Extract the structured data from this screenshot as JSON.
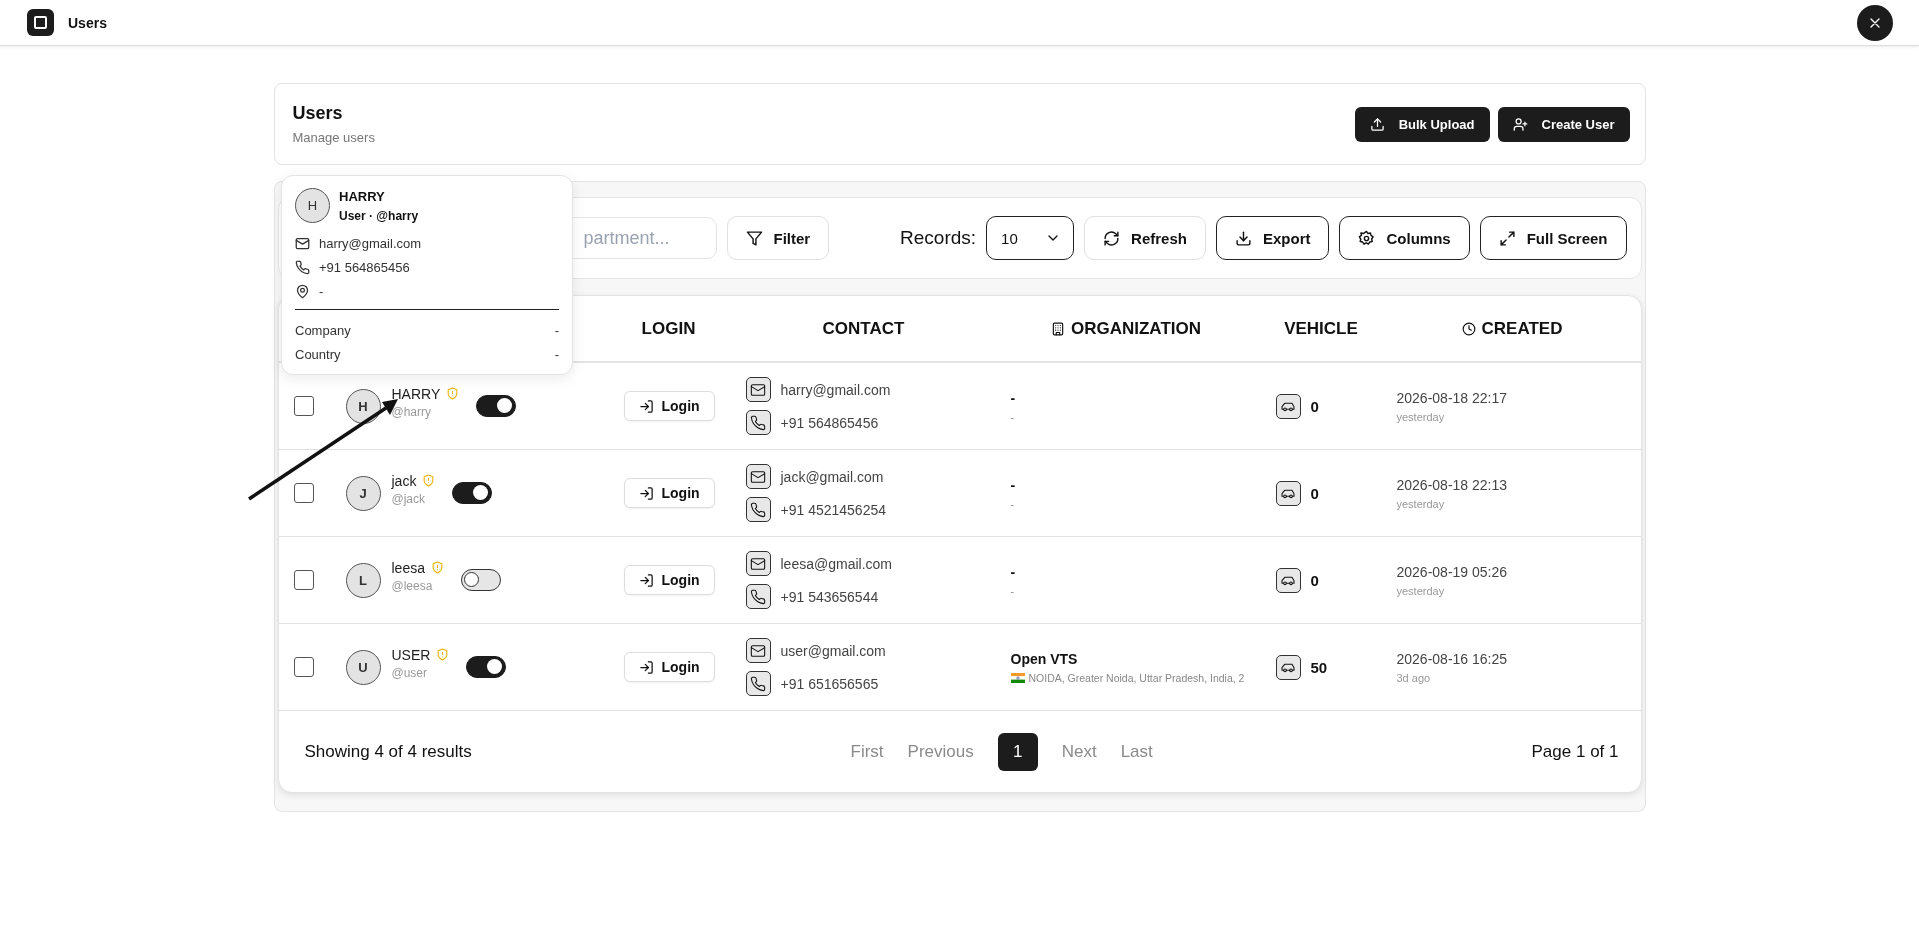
{
  "app_bar": {
    "title": "Users"
  },
  "page_header": {
    "title": "Users",
    "subtitle": "Manage users",
    "actions": [
      "Bulk Upload",
      "Create User"
    ]
  },
  "toolbar": {
    "search": {
      "placeholder": "partment..."
    },
    "filter": {
      "label": "Filter",
      "kind": "plain"
    },
    "records_label": "Records:",
    "records_value": "10",
    "buttons": [
      {
        "label": "Refresh",
        "kind": "plain"
      },
      {
        "label": "Export",
        "kind": "outline"
      },
      {
        "label": "Columns",
        "kind": "outline"
      },
      {
        "label": "Full Screen",
        "kind": "outline"
      }
    ]
  },
  "table": {
    "columns": [
      "LOGIN",
      "CONTACT",
      "ORGANIZATION",
      "VEHICLE",
      "CREATED"
    ],
    "rows": [
      {
        "initial": "H",
        "name": "HARRY",
        "handle": "@harry",
        "checked": false,
        "active": true,
        "login_label": "Login",
        "email": "harry@gmail.com",
        "phone": "+91 564865456",
        "organization": "-",
        "location": "-",
        "flag": false,
        "vehicles": "0",
        "created": "2026-08-18 22:17",
        "created_relative": "yesterday"
      },
      {
        "initial": "J",
        "name": "jack",
        "handle": "@jack",
        "checked": false,
        "active": true,
        "login_label": "Login",
        "email": "jack@gmail.com",
        "phone": "+91 4521456254",
        "organization": "-",
        "location": "-",
        "flag": false,
        "vehicles": "0",
        "created": "2026-08-18 22:13",
        "created_relative": "yesterday"
      },
      {
        "initial": "L",
        "name": "leesa",
        "handle": "@leesa",
        "checked": false,
        "active": false,
        "login_label": "Login",
        "email": "leesa@gmail.com",
        "phone": "+91 543656544",
        "organization": "-",
        "location": "-",
        "flag": false,
        "vehicles": "0",
        "created": "2026-08-19 05:26",
        "created_relative": "yesterday"
      },
      {
        "initial": "U",
        "name": "USER",
        "handle": "@user",
        "checked": false,
        "active": true,
        "login_label": "Login",
        "email": "user@gmail.com",
        "phone": "+91 651656565",
        "organization": "Open VTS",
        "location": "NOIDA, Greater Noida, Uttar Pradesh, India, 2",
        "flag": true,
        "vehicles": "50",
        "created": "2026-08-16 16:25",
        "created_relative": "3d ago"
      }
    ],
    "summary": "Showing 4 of 4 results",
    "pagination": [
      {
        "label": "First",
        "selected": false,
        "disabled": true
      },
      {
        "label": "Previous",
        "selected": false,
        "disabled": true
      },
      {
        "label": "1",
        "selected": true,
        "disabled": false
      },
      {
        "label": "Next",
        "selected": false,
        "disabled": true
      },
      {
        "label": "Last",
        "selected": false,
        "disabled": true
      }
    ],
    "page_info": "Page 1 of 1"
  },
  "user_card": {
    "initial": "H",
    "name": "HARRY",
    "subtitle": "User · @harry",
    "email": "harry@gmail.com",
    "phone": "+91 564865456",
    "address": "-",
    "fields": [
      {
        "label": "Company",
        "value": "-"
      },
      {
        "label": "Country",
        "value": "-"
      }
    ]
  }
}
